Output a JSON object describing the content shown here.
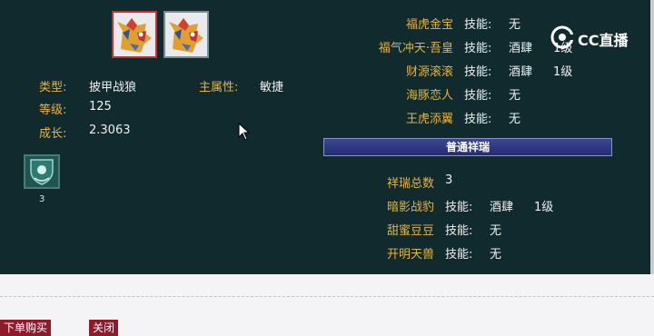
{
  "pet": {
    "type_label": "类型:",
    "type_value": "披甲战狼",
    "main_attr_label": "主属性:",
    "main_attr_value": "敏捷",
    "level_label": "等级:",
    "level_value": "125",
    "growth_label": "成长:",
    "growth_value": "2.3063"
  },
  "badge": {
    "count": "3",
    "icon": "shield-emblem-icon"
  },
  "right_items": [
    {
      "name": "福虎金宝",
      "skill_label": "技能:",
      "value": "无",
      "level": ""
    },
    {
      "name": "福气冲天·吾皇",
      "skill_label": "技能:",
      "value": "酒肆",
      "level": "1级"
    },
    {
      "name": "财源滚滚",
      "skill_label": "技能:",
      "value": "酒肆",
      "level": "1级"
    },
    {
      "name": "海豚恋人",
      "skill_label": "技能:",
      "value": "无",
      "level": ""
    },
    {
      "name": "王虎添翼",
      "skill_label": "技能:",
      "value": "无",
      "level": ""
    }
  ],
  "auspicious": {
    "banner": "普通祥瑞",
    "total_label": "祥瑞总数",
    "total_value": "3",
    "items": [
      {
        "name": "暗影战豹",
        "skill_label": "技能:",
        "value": "酒肆",
        "level": "1级"
      },
      {
        "name": "甜蜜豆豆",
        "skill_label": "技能:",
        "value": "无",
        "level": ""
      },
      {
        "name": "开明天兽",
        "skill_label": "技能:",
        "value": "无",
        "level": ""
      }
    ]
  },
  "watermark": {
    "text": "CC直播"
  },
  "footer": {
    "buy_label": "下单购买",
    "close_label": "关闭"
  },
  "colors": {
    "panel_bg": "#102a2e",
    "label_gold": "#e8b43a",
    "button_bg": "#8c1c2c",
    "banner_bg": "#2a3478"
  }
}
